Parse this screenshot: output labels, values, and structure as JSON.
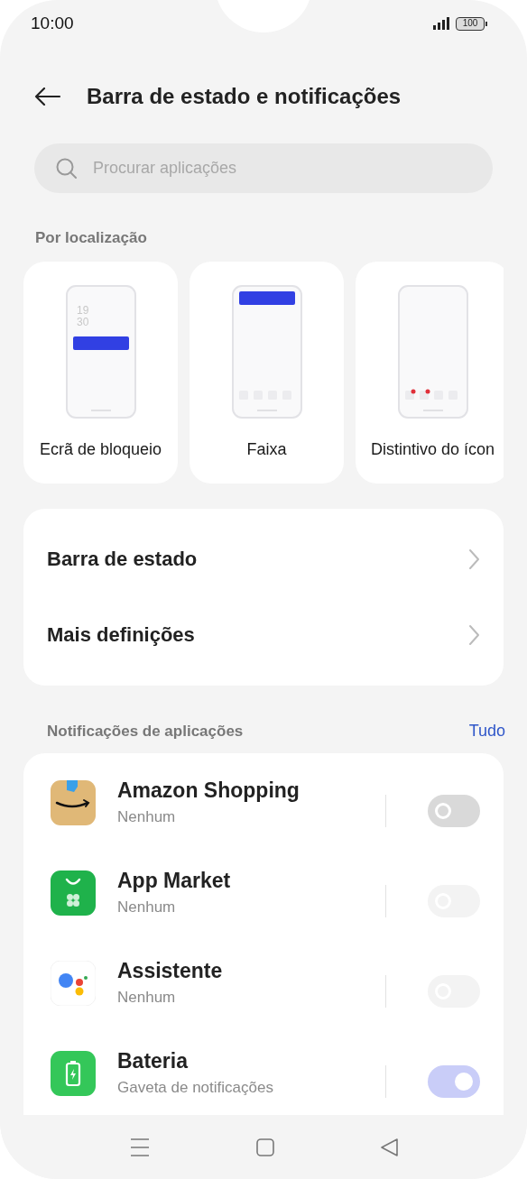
{
  "status_bar": {
    "time": "10:00",
    "battery": "100"
  },
  "header": {
    "title": "Barra de estado e notificações"
  },
  "search": {
    "placeholder": "Procurar aplicações"
  },
  "by_location": {
    "heading": "Por localização",
    "cards": [
      {
        "label": "Ecrã de bloqueio",
        "kind": "lockscreen",
        "clock": [
          "19",
          "30"
        ]
      },
      {
        "label": "Faixa",
        "kind": "banner"
      },
      {
        "label": "Distintivo do ícon",
        "kind": "badge"
      }
    ]
  },
  "settings": [
    {
      "label": "Barra de estado"
    },
    {
      "label": "Mais definições"
    }
  ],
  "app_notifications": {
    "heading": "Notificações de aplicações",
    "action": "Tudo",
    "apps": [
      {
        "name": "Amazon Shopping",
        "status": "Nenhum",
        "on": false,
        "disabled": false
      },
      {
        "name": "App Market",
        "status": "Nenhum",
        "on": false,
        "disabled": true
      },
      {
        "name": "Assistente",
        "status": "Nenhum",
        "on": false,
        "disabled": true
      },
      {
        "name": "Bateria",
        "status": "Gaveta de notificações",
        "on": true,
        "disabled": true
      }
    ]
  }
}
